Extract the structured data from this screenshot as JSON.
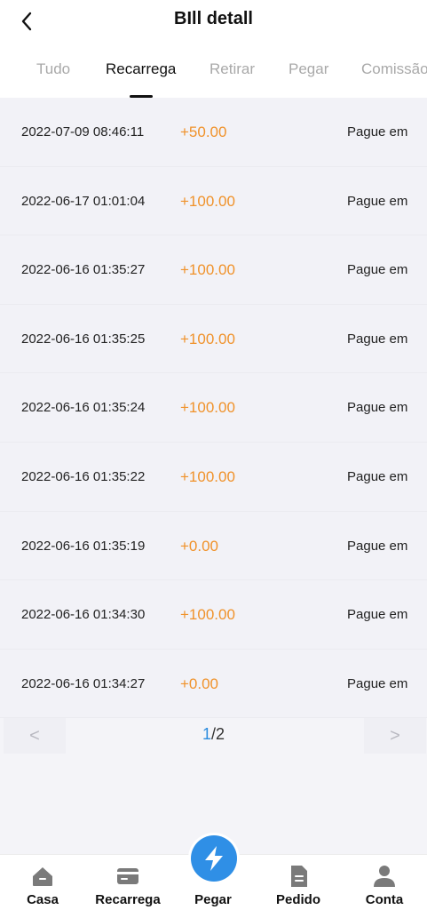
{
  "header": {
    "title": "BIll detall"
  },
  "tabs": [
    {
      "label": "Tudo"
    },
    {
      "label": "Recarrega"
    },
    {
      "label": "Retirar"
    },
    {
      "label": "Pegar"
    },
    {
      "label": "Comissão"
    }
  ],
  "active_tab": "Recarrega",
  "records": [
    {
      "date": "2022-07-09 08:46:11",
      "amount": "+50.00",
      "status": "Pague em"
    },
    {
      "date": "2022-06-17 01:01:04",
      "amount": "+100.00",
      "status": "Pague em"
    },
    {
      "date": "2022-06-16 01:35:27",
      "amount": "+100.00",
      "status": "Pague em"
    },
    {
      "date": "2022-06-16 01:35:25",
      "amount": "+100.00",
      "status": "Pague em"
    },
    {
      "date": "2022-06-16 01:35:24",
      "amount": "+100.00",
      "status": "Pague em"
    },
    {
      "date": "2022-06-16 01:35:22",
      "amount": "+100.00",
      "status": "Pague em"
    },
    {
      "date": "2022-06-16 01:35:19",
      "amount": "+0.00",
      "status": "Pague em"
    },
    {
      "date": "2022-06-16 01:34:30",
      "amount": "+100.00",
      "status": "Pague em"
    },
    {
      "date": "2022-06-16 01:34:27",
      "amount": "+0.00",
      "status": "Pague em"
    }
  ],
  "pagination": {
    "prev": "<",
    "current": "1",
    "total": "/2",
    "next": ">"
  },
  "tabbar": [
    {
      "label": "Casa",
      "icon": "home-icon"
    },
    {
      "label": "Recarrega",
      "icon": "card-icon"
    },
    {
      "label": "Pegar",
      "icon": "lightning-icon"
    },
    {
      "label": "Pedido",
      "icon": "document-icon"
    },
    {
      "label": "Conta",
      "icon": "user-icon"
    }
  ],
  "colors": {
    "amount": "#f0922a",
    "accent": "#2f8fe6",
    "page_current": "#2a8bde"
  }
}
